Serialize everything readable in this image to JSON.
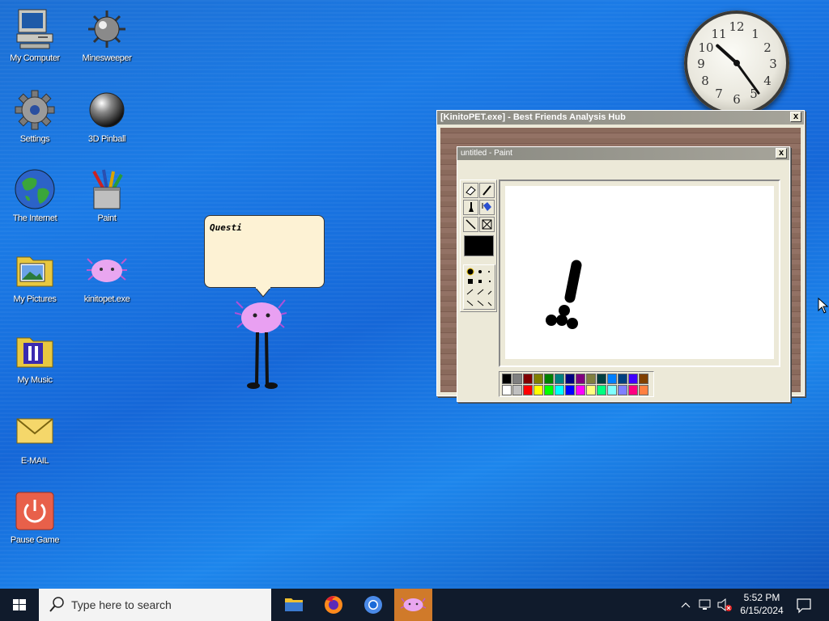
{
  "desktop_icons": [
    {
      "label": "My Computer",
      "icon": "computer-icon"
    },
    {
      "label": "Minesweeper",
      "icon": "mine-icon"
    },
    {
      "label": "Settings",
      "icon": "gear-icon"
    },
    {
      "label": "3D Pinball",
      "icon": "pinball-icon"
    },
    {
      "label": "The Internet",
      "icon": "globe-icon"
    },
    {
      "label": "Paint",
      "icon": "paint-bucket-icon"
    },
    {
      "label": "My Pictures",
      "icon": "pictures-folder-icon"
    },
    {
      "label": "kinitopet.exe",
      "icon": "axolotl-icon"
    },
    {
      "label": "My Music",
      "icon": "music-folder-icon"
    },
    {
      "label": "E-MAIL",
      "icon": "envelope-icon"
    },
    {
      "label": "Pause Game",
      "icon": "power-icon"
    }
  ],
  "speech_bubble": {
    "text": "Questi"
  },
  "clock": {
    "numbers": [
      "12",
      "1",
      "2",
      "3",
      "4",
      "5",
      "6",
      "7",
      "8",
      "9",
      "10",
      "11"
    ],
    "hour": 10,
    "minute": 24
  },
  "kinito_window": {
    "title": "[KinitoPET.exe] - Best Friends Analysis Hub",
    "close": "x"
  },
  "paint_window": {
    "title": "untitled - Paint",
    "close": "x"
  },
  "palette": {
    "top": [
      "#000000",
      "#808080",
      "#800000",
      "#808000",
      "#008000",
      "#008080",
      "#000080",
      "#800080",
      "#808040",
      "#004040",
      "#0080ff",
      "#004080",
      "#4000ff",
      "#804000"
    ],
    "bottom": [
      "#ffffff",
      "#c0c0c0",
      "#ff0000",
      "#ffff00",
      "#00ff00",
      "#00ffff",
      "#0000ff",
      "#ff00ff",
      "#ffff80",
      "#00ff80",
      "#80ffff",
      "#8080ff",
      "#ff0080",
      "#ff8040"
    ]
  },
  "taskbar": {
    "search_placeholder": "Type here to search",
    "time": "5:52 PM",
    "date": "6/15/2024"
  }
}
